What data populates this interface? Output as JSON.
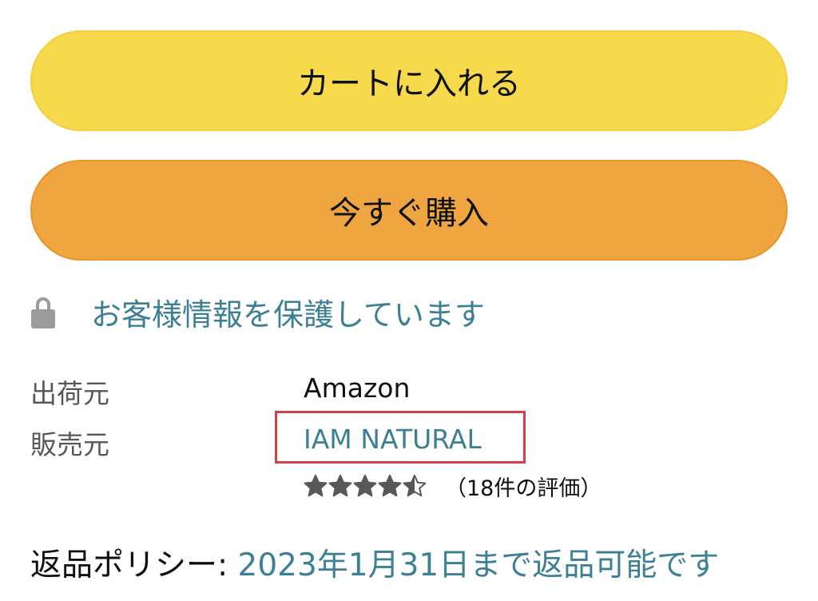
{
  "buttons": {
    "add_to_cart": "カートに入れる",
    "buy_now": "今すぐ購入"
  },
  "secure": {
    "icon": "lock-icon",
    "text": "お客様情報を保護しています"
  },
  "fulfillment": {
    "ships_from_label": "出荷元",
    "ships_from_value": "Amazon",
    "sold_by_label": "販売元",
    "sold_by_value": "IAM NATURAL"
  },
  "seller_rating": {
    "stars": 4.5,
    "max_stars": 5,
    "count_text": "（18件の評価）"
  },
  "return_policy": {
    "label": "返品ポリシー: ",
    "link_text": "2023年1月31日まで返品可能です"
  },
  "colors": {
    "cart_button": "#f7d94c",
    "buy_button": "#efa540",
    "link": "#3d8094",
    "highlight_box": "#d4414a",
    "star": "#565959"
  }
}
